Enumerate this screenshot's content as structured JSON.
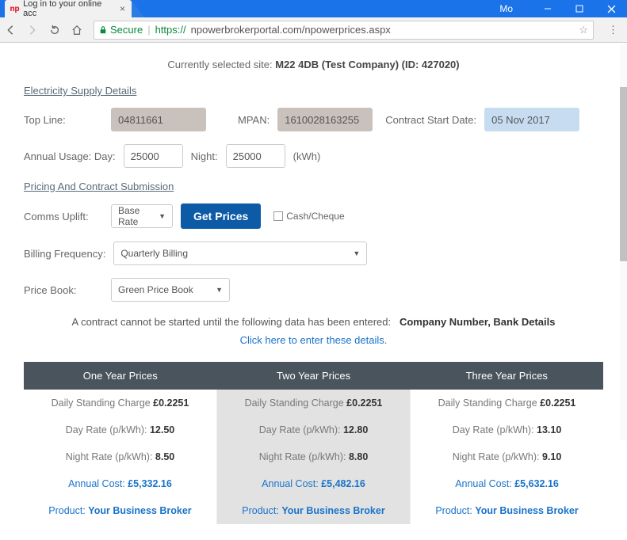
{
  "browser": {
    "tab_title": "Log in to your online acc",
    "user": "Mo",
    "secure_label": "Secure",
    "url_proto": "https://",
    "url_rest": "npowerbrokerportal.com/npowerprices.aspx"
  },
  "header": {
    "selected_site_label": "Currently selected site:",
    "selected_site_value": "M22 4DB (Test Company) (ID: 427020)"
  },
  "sections": {
    "supply_heading": "Electricity Supply Details",
    "pricing_heading": "Pricing And Contract Submission"
  },
  "supply": {
    "top_line_label": "Top Line:",
    "top_line_value": "04811661",
    "mpan_label": "MPAN:",
    "mpan_value": "1610028163255",
    "cstart_label": "Contract Start Date:",
    "cstart_value": "05 Nov 2017",
    "annual_usage_label": "Annual Usage:",
    "day_label": "Day:",
    "day_value": "25000",
    "night_label": "Night:",
    "night_value": "25000",
    "unit": "(kWh)"
  },
  "pricing": {
    "comms_uplift_label": "Comms Uplift:",
    "comms_uplift_select": "Base Rate",
    "get_prices_btn": "Get Prices",
    "cash_cheque_label": "Cash/Cheque",
    "billing_freq_label": "Billing Frequency:",
    "billing_freq_select": "Quarterly Billing",
    "price_book_label": "Price Book:",
    "price_book_select": "Green Price Book"
  },
  "notice": {
    "text": "A contract cannot be started until the following data has been entered:",
    "strong": "Company Number, Bank Details",
    "link": "Click here to enter these details."
  },
  "table": {
    "headers": [
      "One Year Prices",
      "Two Year Prices",
      "Three Year Prices"
    ],
    "rows": [
      {
        "label": "Daily Standing Charge",
        "values": [
          "£0.2251",
          "£0.2251",
          "£0.2251"
        ]
      },
      {
        "label": "Day Rate (p/kWh):",
        "values": [
          "12.50",
          "12.80",
          "13.10"
        ]
      },
      {
        "label": "Night Rate (p/kWh):",
        "values": [
          "8.50",
          "8.80",
          "9.10"
        ]
      },
      {
        "label": "Annual Cost:",
        "values": [
          "£5,332.16",
          "£5,482.16",
          "£5,632.16"
        ],
        "link": true
      },
      {
        "label": "Product:",
        "values": [
          "Your Business Broker",
          "Your Business Broker",
          "Your Business Broker"
        ],
        "link": true
      }
    ]
  }
}
